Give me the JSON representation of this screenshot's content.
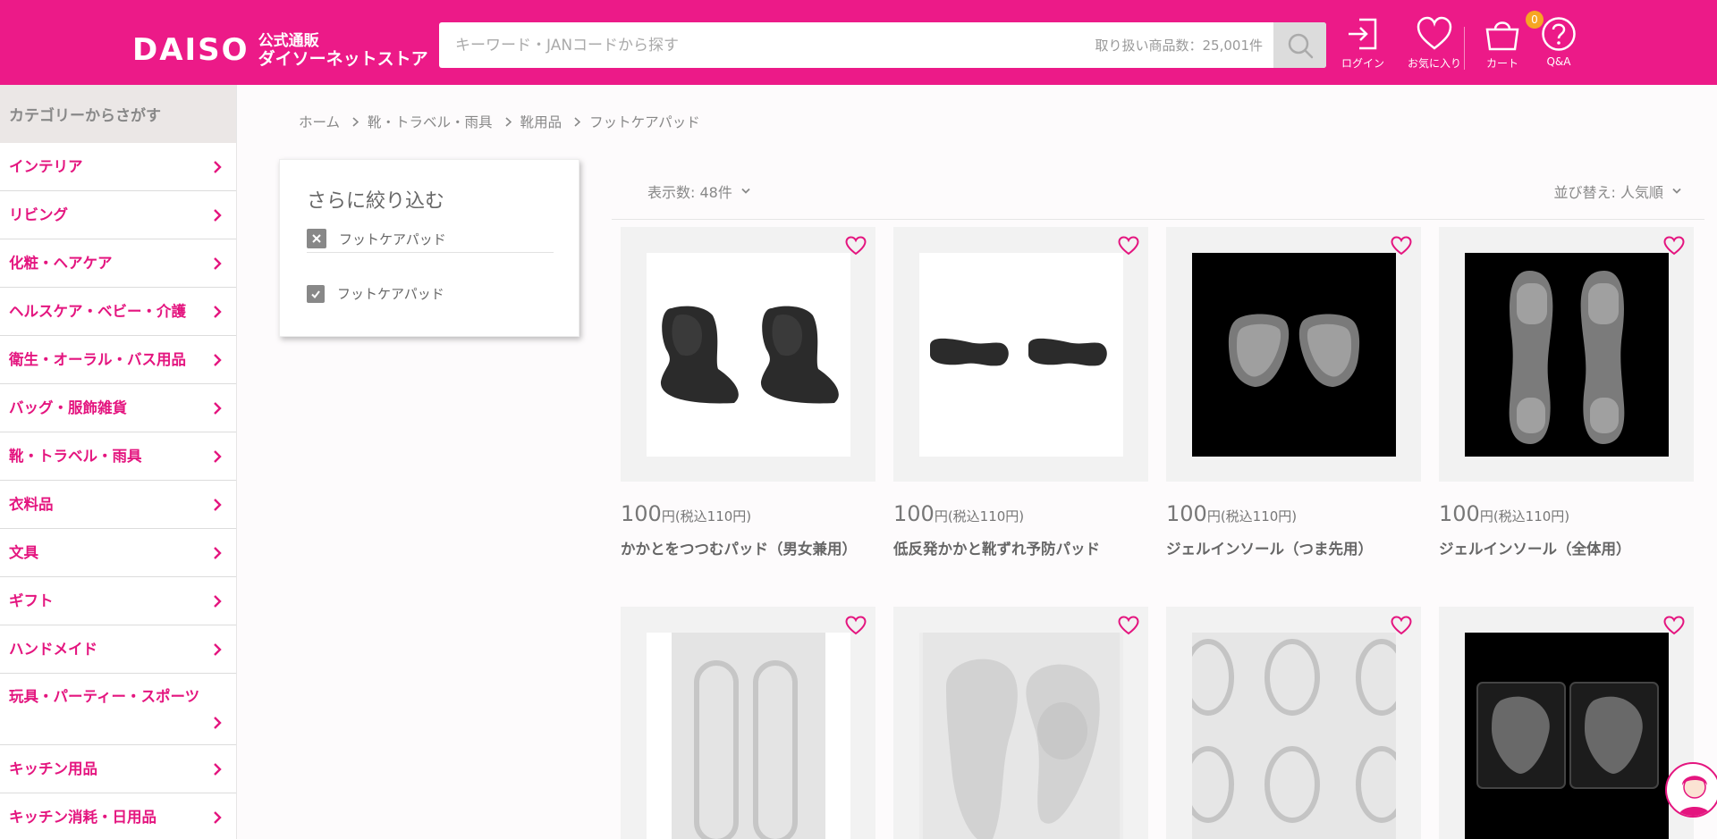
{
  "header": {
    "logo_text": "DAISO",
    "logo_sub1": "公式通販",
    "logo_sub2": "ダイソーネットストア",
    "search_placeholder": "キーワード・JANコードから探す",
    "search_count": "取り扱い商品数：25,001件",
    "nav": {
      "login": "ログイン",
      "favorites": "お気に入り",
      "cart": "カート",
      "cart_count": "0",
      "qa": "Q&A"
    },
    "colors": {
      "brand": "#ec1a88",
      "badge": "#f6a623"
    }
  },
  "sidebar": {
    "title": "カテゴリーからさがす",
    "items": [
      "インテリア",
      "リビング",
      "化粧・ヘアケア",
      "ヘルスケア・ベビー・介護",
      "衛生・オーラル・バス用品",
      "バッグ・服飾雑貨",
      "靴・トラベル・雨具",
      "衣料品",
      "文具",
      "ギフト",
      "ハンドメイド",
      "玩具・パーティー・スポーツ",
      "キッチン用品",
      "キッチン消耗・日用品"
    ]
  },
  "breadcrumb": [
    "ホーム",
    "靴・トラベル・雨具",
    "靴用品",
    "フットケアパッド"
  ],
  "filter": {
    "title": "さらに絞り込む",
    "active": "フットケアパッド",
    "option": "フットケアパッド"
  },
  "toolbar": {
    "display_count": "表示数: 48件",
    "sort": "並び替え: 人気順"
  },
  "products": [
    {
      "price": "100",
      "unit": "円",
      "tax": "(税込110円)",
      "name": "かかとをつつむパッド（男女兼用）",
      "image": "black-heel-wrap-pads"
    },
    {
      "price": "100",
      "unit": "円",
      "tax": "(税込110円)",
      "name": "低反発かかと靴ずれ予防パッド",
      "image": "black-heel-strip-pads"
    },
    {
      "price": "100",
      "unit": "円",
      "tax": "(税込110円)",
      "name": "ジェルインソール（つま先用）",
      "image": "clear-toe-gel-insoles"
    },
    {
      "price": "100",
      "unit": "円",
      "tax": "(税込110円)",
      "name": "ジェルインソール（全体用）",
      "image": "clear-full-gel-insoles"
    },
    {
      "image": "clear-gel-strips"
    },
    {
      "image": "clear-gel-arch-pads"
    },
    {
      "image": "clear-oval-gel-pads"
    },
    {
      "image": "clear-heel-gel-cups"
    }
  ]
}
